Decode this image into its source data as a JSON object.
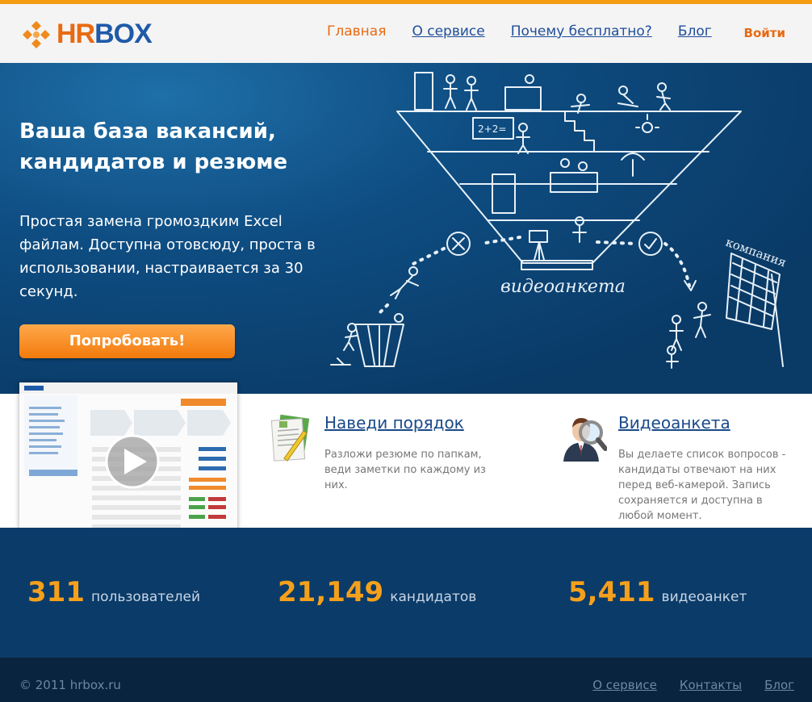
{
  "brand": {
    "hr": "HR",
    "box": "BOX"
  },
  "nav": {
    "items": [
      "Главная",
      "О сервисе",
      "Почему бесплатно?",
      "Блог"
    ],
    "login": "Войти"
  },
  "hero": {
    "title": "Ваша база вакансий, кандидатов и резюме",
    "description": "Простая замена громоздким Excel файлам. Доступна отовсюду, проста в использовании, настраивается за 30 секунд.",
    "cta": "Попробовать!",
    "sketch_labels": {
      "videoform": "видеоанкета",
      "company": "компания",
      "formula": "2+2="
    }
  },
  "features": [
    {
      "title": "Наведи порядок",
      "text": "Разложи резюме по папкам, веди заметки по каждому из них.",
      "icon": "document-pencil-icon"
    },
    {
      "title": "Видеоанкета",
      "text": "Вы делаете список вопросов - кандидаты отвечают на них перед веб-камерой. Запись сохраняется и доступна в любой момент.",
      "icon": "person-magnifier-icon"
    }
  ],
  "stats": [
    {
      "value": "311",
      "label": "пользователей"
    },
    {
      "value": "21,149",
      "label": "кандидатов"
    },
    {
      "value": "5,411",
      "label": "видеоанкет"
    }
  ],
  "footer": {
    "copyright": "© 2011 hrbox.ru",
    "links": [
      "О сервисе",
      "Контакты",
      "Блог"
    ]
  },
  "colors": {
    "accent": "#f39c12",
    "brand_orange": "#e86a12",
    "brand_blue": "#1f5aa8",
    "hero_bg": "#0a3a66",
    "stat_number": "#f5a01c"
  }
}
